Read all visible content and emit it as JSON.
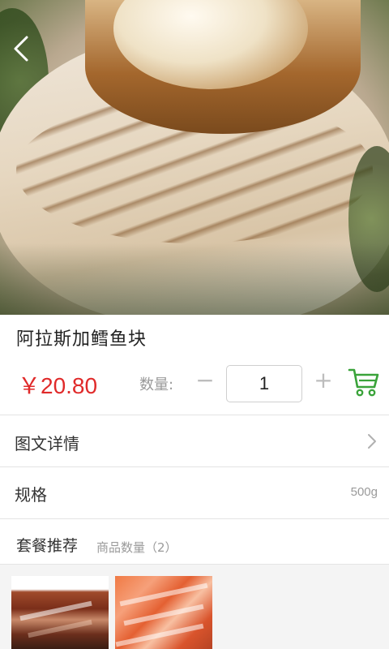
{
  "product": {
    "name": "阿拉斯加鳕鱼块",
    "price": "￥20.80",
    "quantity_label": "数量:",
    "quantity_value": "1",
    "minus": "−",
    "plus": "+"
  },
  "detail_rows": [
    {
      "label": "图文详情"
    },
    {
      "label": "规格",
      "value": "500g"
    }
  ],
  "combo": {
    "title": "套餐推荐",
    "count_text": "商品数量（2）"
  },
  "icons": {
    "back": "chevron-left-icon",
    "cart": "shopping-cart-icon",
    "row_chevron": "chevron-right-icon"
  },
  "colors": {
    "price": "#e02a2a",
    "cart": "#3aa33a",
    "muted": "#9a9a9a"
  }
}
